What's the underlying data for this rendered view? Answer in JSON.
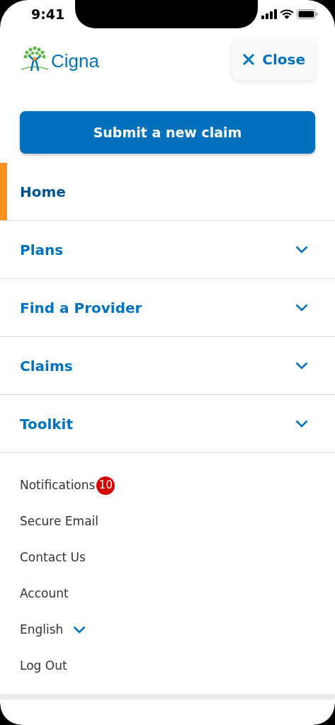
{
  "status_bar": {
    "time": "9:41"
  },
  "header": {
    "logo_text": "Cigna",
    "close_label": "Close"
  },
  "primary_action": "Submit a new claim",
  "nav_items": [
    {
      "label": "Home",
      "selected": true,
      "expandable": false
    },
    {
      "label": "Plans",
      "selected": false,
      "expandable": true
    },
    {
      "label": "Find a Provider",
      "selected": false,
      "expandable": true
    },
    {
      "label": "Claims",
      "selected": false,
      "expandable": true
    },
    {
      "label": "Toolkit",
      "selected": false,
      "expandable": true
    }
  ],
  "secondary_links": [
    {
      "label": "Notifications",
      "kind": "link",
      "badge": "10"
    },
    {
      "label": "Secure Email",
      "kind": "link"
    },
    {
      "label": "Contact Us",
      "kind": "link"
    },
    {
      "label": "Account",
      "kind": "link"
    },
    {
      "label": "English",
      "kind": "dropdown"
    },
    {
      "label": "Log Out",
      "kind": "link"
    }
  ]
}
